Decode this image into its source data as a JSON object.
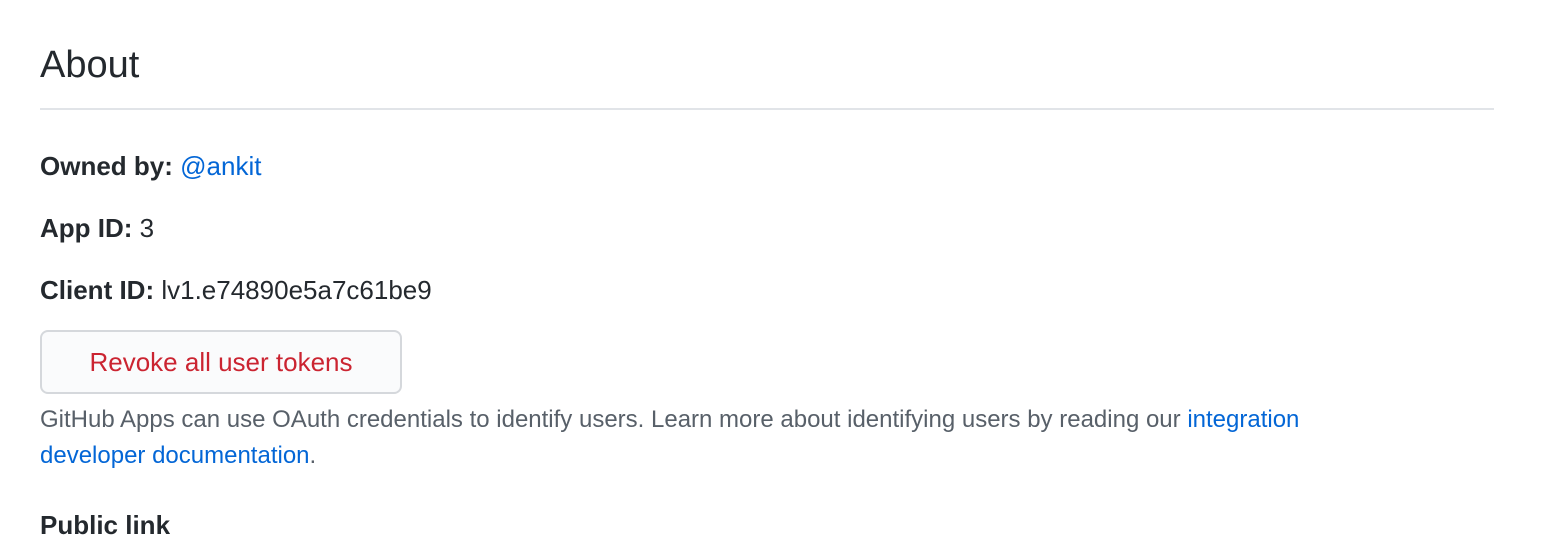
{
  "section": {
    "title": "About"
  },
  "owner": {
    "label": "Owned by:",
    "value": "@ankit"
  },
  "app_id": {
    "label": "App ID:",
    "value": "3"
  },
  "client_id": {
    "label": "Client ID:",
    "value": "lv1.e74890e5a7c61be9"
  },
  "revoke_button": {
    "label": "Revoke all user tokens"
  },
  "help": {
    "text": "GitHub Apps can use OAuth credentials to identify users. Learn more about identifying users by reading our ",
    "link_line1": "integration",
    "link_line2": "developer documentation",
    "suffix": "."
  },
  "public_link": {
    "heading": "Public link"
  },
  "colors": {
    "link": "#0366d6",
    "danger": "#cb2431",
    "muted_text": "#586069",
    "divider": "#e1e4e8"
  }
}
